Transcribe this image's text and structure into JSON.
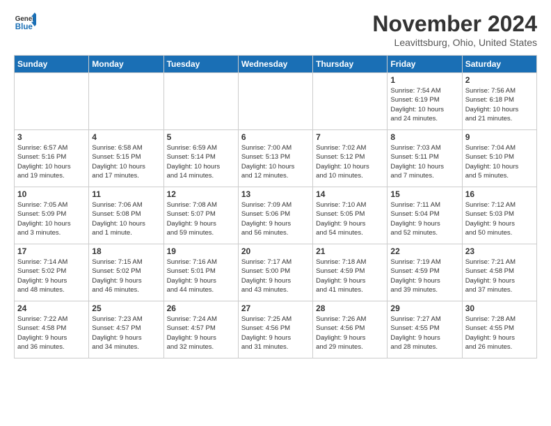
{
  "header": {
    "logo_line1": "General",
    "logo_line2": "Blue",
    "month": "November 2024",
    "location": "Leavittsburg, Ohio, United States"
  },
  "days_of_week": [
    "Sunday",
    "Monday",
    "Tuesday",
    "Wednesday",
    "Thursday",
    "Friday",
    "Saturday"
  ],
  "weeks": [
    [
      {
        "day": "",
        "info": ""
      },
      {
        "day": "",
        "info": ""
      },
      {
        "day": "",
        "info": ""
      },
      {
        "day": "",
        "info": ""
      },
      {
        "day": "",
        "info": ""
      },
      {
        "day": "1",
        "info": "Sunrise: 7:54 AM\nSunset: 6:19 PM\nDaylight: 10 hours\nand 24 minutes."
      },
      {
        "day": "2",
        "info": "Sunrise: 7:56 AM\nSunset: 6:18 PM\nDaylight: 10 hours\nand 21 minutes."
      }
    ],
    [
      {
        "day": "3",
        "info": "Sunrise: 6:57 AM\nSunset: 5:16 PM\nDaylight: 10 hours\nand 19 minutes."
      },
      {
        "day": "4",
        "info": "Sunrise: 6:58 AM\nSunset: 5:15 PM\nDaylight: 10 hours\nand 17 minutes."
      },
      {
        "day": "5",
        "info": "Sunrise: 6:59 AM\nSunset: 5:14 PM\nDaylight: 10 hours\nand 14 minutes."
      },
      {
        "day": "6",
        "info": "Sunrise: 7:00 AM\nSunset: 5:13 PM\nDaylight: 10 hours\nand 12 minutes."
      },
      {
        "day": "7",
        "info": "Sunrise: 7:02 AM\nSunset: 5:12 PM\nDaylight: 10 hours\nand 10 minutes."
      },
      {
        "day": "8",
        "info": "Sunrise: 7:03 AM\nSunset: 5:11 PM\nDaylight: 10 hours\nand 7 minutes."
      },
      {
        "day": "9",
        "info": "Sunrise: 7:04 AM\nSunset: 5:10 PM\nDaylight: 10 hours\nand 5 minutes."
      }
    ],
    [
      {
        "day": "10",
        "info": "Sunrise: 7:05 AM\nSunset: 5:09 PM\nDaylight: 10 hours\nand 3 minutes."
      },
      {
        "day": "11",
        "info": "Sunrise: 7:06 AM\nSunset: 5:08 PM\nDaylight: 10 hours\nand 1 minute."
      },
      {
        "day": "12",
        "info": "Sunrise: 7:08 AM\nSunset: 5:07 PM\nDaylight: 9 hours\nand 59 minutes."
      },
      {
        "day": "13",
        "info": "Sunrise: 7:09 AM\nSunset: 5:06 PM\nDaylight: 9 hours\nand 56 minutes."
      },
      {
        "day": "14",
        "info": "Sunrise: 7:10 AM\nSunset: 5:05 PM\nDaylight: 9 hours\nand 54 minutes."
      },
      {
        "day": "15",
        "info": "Sunrise: 7:11 AM\nSunset: 5:04 PM\nDaylight: 9 hours\nand 52 minutes."
      },
      {
        "day": "16",
        "info": "Sunrise: 7:12 AM\nSunset: 5:03 PM\nDaylight: 9 hours\nand 50 minutes."
      }
    ],
    [
      {
        "day": "17",
        "info": "Sunrise: 7:14 AM\nSunset: 5:02 PM\nDaylight: 9 hours\nand 48 minutes."
      },
      {
        "day": "18",
        "info": "Sunrise: 7:15 AM\nSunset: 5:02 PM\nDaylight: 9 hours\nand 46 minutes."
      },
      {
        "day": "19",
        "info": "Sunrise: 7:16 AM\nSunset: 5:01 PM\nDaylight: 9 hours\nand 44 minutes."
      },
      {
        "day": "20",
        "info": "Sunrise: 7:17 AM\nSunset: 5:00 PM\nDaylight: 9 hours\nand 43 minutes."
      },
      {
        "day": "21",
        "info": "Sunrise: 7:18 AM\nSunset: 4:59 PM\nDaylight: 9 hours\nand 41 minutes."
      },
      {
        "day": "22",
        "info": "Sunrise: 7:19 AM\nSunset: 4:59 PM\nDaylight: 9 hours\nand 39 minutes."
      },
      {
        "day": "23",
        "info": "Sunrise: 7:21 AM\nSunset: 4:58 PM\nDaylight: 9 hours\nand 37 minutes."
      }
    ],
    [
      {
        "day": "24",
        "info": "Sunrise: 7:22 AM\nSunset: 4:58 PM\nDaylight: 9 hours\nand 36 minutes."
      },
      {
        "day": "25",
        "info": "Sunrise: 7:23 AM\nSunset: 4:57 PM\nDaylight: 9 hours\nand 34 minutes."
      },
      {
        "day": "26",
        "info": "Sunrise: 7:24 AM\nSunset: 4:57 PM\nDaylight: 9 hours\nand 32 minutes."
      },
      {
        "day": "27",
        "info": "Sunrise: 7:25 AM\nSunset: 4:56 PM\nDaylight: 9 hours\nand 31 minutes."
      },
      {
        "day": "28",
        "info": "Sunrise: 7:26 AM\nSunset: 4:56 PM\nDaylight: 9 hours\nand 29 minutes."
      },
      {
        "day": "29",
        "info": "Sunrise: 7:27 AM\nSunset: 4:55 PM\nDaylight: 9 hours\nand 28 minutes."
      },
      {
        "day": "30",
        "info": "Sunrise: 7:28 AM\nSunset: 4:55 PM\nDaylight: 9 hours\nand 26 minutes."
      }
    ]
  ]
}
